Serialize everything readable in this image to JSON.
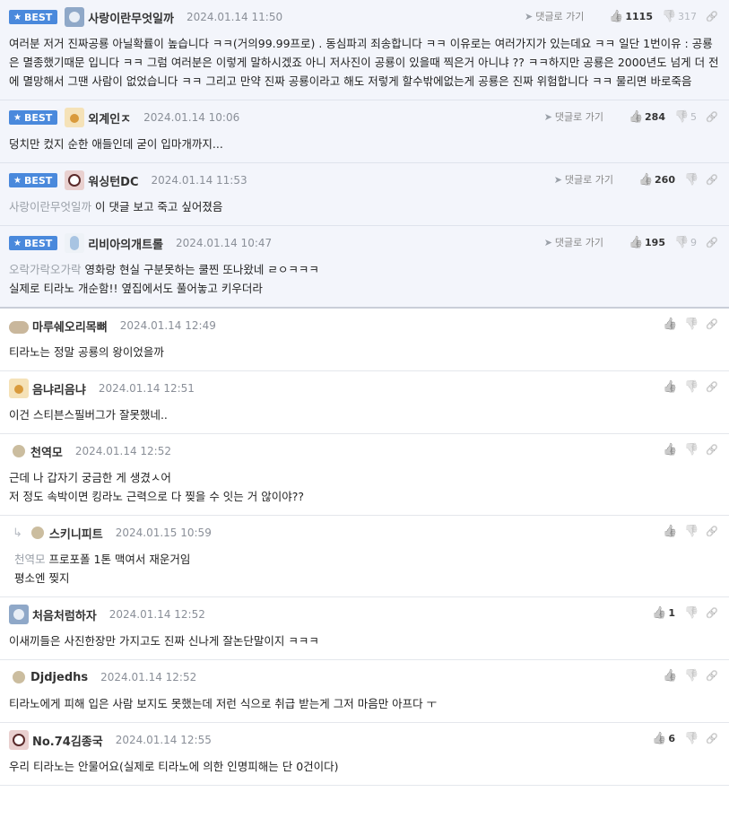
{
  "labels": {
    "best": "BEST",
    "goto": "댓글로 가기"
  },
  "colors": {
    "best_badge": "#4a89dc",
    "best_bg": "#f3f5fb"
  },
  "icons": {
    "up": "thumbs-up-icon",
    "down": "thumbs-down-icon",
    "link": "link-icon",
    "goto": "send-arrow-icon"
  },
  "comments": [
    {
      "best": true,
      "avatar": "koala",
      "nick": "사랑이란무엇일까",
      "date": "2024.01.14 11:50",
      "up": "1115",
      "down": "317",
      "lines": [
        "여러분 저거 진짜공룡 아닐확률이 높습니다 ㅋㅋ(거의99.99프로) . 동심파괴 죄송합니다 ㅋㅋ 이유로는 여러가지가 있는데요 ㅋㅋ 일단 1번이유 : 공룡은 멸종했기때문 입니다 ㅋㅋ 그럼 여러분은 이렇게 말하시겠죠 아니 저사진이 공룡이 있을때 찍은거 아니냐 ?? ㅋㅋ하지만 공룡은 2000년도 넘게 더 전에 멸망해서 그땐 사람이 없었습니다 ㅋㅋ 그리고 만약 진짜 공룡이라고 해도 저렇게 할수밖에없는게 공룡은 진짜 위험합니다 ㅋㅋ 물리면 바로죽음"
      ]
    },
    {
      "best": true,
      "avatar": "dog",
      "nick": "외계인ㅈ",
      "date": "2024.01.14 10:06",
      "up": "284",
      "down": "5",
      "lines": [
        "덩치만 컸지 순한 애들인데 굳이 입마개까지..."
      ]
    },
    {
      "best": true,
      "avatar": "panda",
      "nick": "워싱턴DC",
      "date": "2024.01.14 11:53",
      "up": "260",
      "down": "",
      "mention": "사랑이란무엇일까",
      "lines": [
        "이 댓글 보고 죽고 싶어졌음"
      ]
    },
    {
      "best": true,
      "avatar": "bird",
      "nick": "리비아의개트롤",
      "date": "2024.01.14 10:47",
      "up": "195",
      "down": "9",
      "mention": "오락가락오가락",
      "lines": [
        "영화랑 현실 구분못하는 쿨찐 또나왔네 ㄹㅇㅋㅋㅋ",
        "실제로 티라노 개순함!! 옆집에서도 풀어놓고 키우더라"
      ]
    },
    {
      "best": false,
      "avatar": "mole",
      "nick": "마루쉐오리목뼈",
      "date": "2024.01.14 12:49",
      "up": "",
      "down": "",
      "lines": [
        "티라노는 정말 공룡의 왕이었을까"
      ]
    },
    {
      "best": false,
      "avatar": "dog",
      "nick": "음냐리음냐",
      "date": "2024.01.14 12:51",
      "up": "",
      "down": "",
      "lines": [
        "이건 스티븐스필버그가 잘못했네.."
      ]
    },
    {
      "best": false,
      "avatar": "dot",
      "nick": "천역모",
      "date": "2024.01.14 12:52",
      "up": "",
      "down": "",
      "lines": [
        "근데 나 갑자기 궁금한 게 생겼ㅅ어",
        "저 정도 속박이면 킹라노 근력으로 다 찢을 수 잇는 거 않이야??"
      ]
    },
    {
      "best": false,
      "reply": true,
      "avatar": "dot",
      "nick": "스키니피트",
      "date": "2024.01.15 10:59",
      "up": "",
      "down": "",
      "mention": "천역모",
      "lines": [
        "프로포폴 1톤 맥여서 재운거임",
        "평소엔 찢지"
      ]
    },
    {
      "best": false,
      "avatar": "koala",
      "nick": "처음처럼하자",
      "date": "2024.01.14 12:52",
      "up": "1",
      "down": "",
      "lines": [
        "이새끼들은 사진한장만 가지고도 진짜 신나게 잘논단말이지 ㅋㅋㅋ"
      ]
    },
    {
      "best": false,
      "avatar": "dot",
      "nick": "Djdjedhs",
      "date": "2024.01.14 12:52",
      "up": "",
      "down": "",
      "lines": [
        "티라노에게 피해 입은 사람 보지도 못했는데 저런 식으로 취급 받는게 그저 마음만 아프다 ㅜ"
      ]
    },
    {
      "best": false,
      "avatar": "panda",
      "nick": "No.74김종국",
      "date": "2024.01.14 12:55",
      "up": "6",
      "down": "",
      "lines": [
        "우리 티라노는 안물어요(실제로 티라노에 의한 인명피해는 단 0건이다)"
      ]
    }
  ]
}
